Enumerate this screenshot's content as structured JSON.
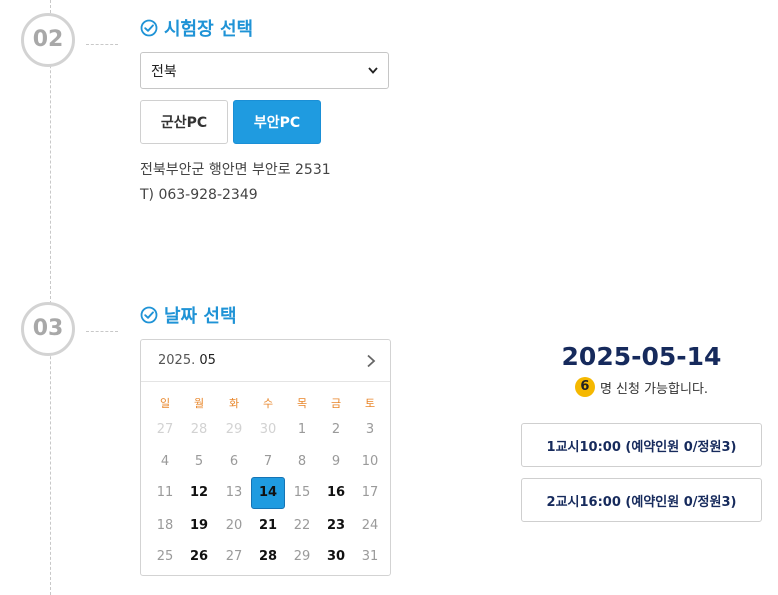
{
  "step2": {
    "number": "02",
    "title": "시험장 선택",
    "region_select": {
      "value": "전북"
    },
    "centers": [
      {
        "label": "군산PC",
        "selected": false
      },
      {
        "label": "부안PC",
        "selected": true
      }
    ],
    "address": "전북부안군 행안면 부안로 2531",
    "phone": "T) 063-928-2349"
  },
  "step3": {
    "number": "03",
    "title": "날짜 선택",
    "calendar": {
      "year": "2025.",
      "month": "05",
      "weekdays": [
        "일",
        "월",
        "화",
        "수",
        "목",
        "금",
        "토"
      ],
      "weeks": [
        [
          "27",
          "28",
          "29",
          "30",
          "1",
          "2",
          "3"
        ],
        [
          "4",
          "5",
          "6",
          "7",
          "8",
          "9",
          "10"
        ],
        [
          "11",
          "12",
          "13",
          "14",
          "15",
          "16",
          "17"
        ],
        [
          "18",
          "19",
          "20",
          "21",
          "22",
          "23",
          "24"
        ],
        [
          "25",
          "26",
          "27",
          "28",
          "29",
          "30",
          "31"
        ]
      ],
      "prev_month_days": [
        "27",
        "28",
        "29",
        "30"
      ],
      "available_days": [
        "12",
        "14",
        "16",
        "19",
        "21",
        "23",
        "26",
        "28",
        "30"
      ],
      "selected_day": "14"
    }
  },
  "selection": {
    "date": "2025-05-14",
    "count": "6",
    "count_suffix": "명 신청 가능합니다.",
    "slots": [
      "1교시10:00 (예약인원 0/정원3)",
      "2교시16:00 (예약인원 0/정원3)"
    ]
  },
  "colors": {
    "accent": "#1f9be0",
    "title_blue": "#1f93d6",
    "dark_navy": "#162a5c",
    "badge": "#f5b800"
  }
}
